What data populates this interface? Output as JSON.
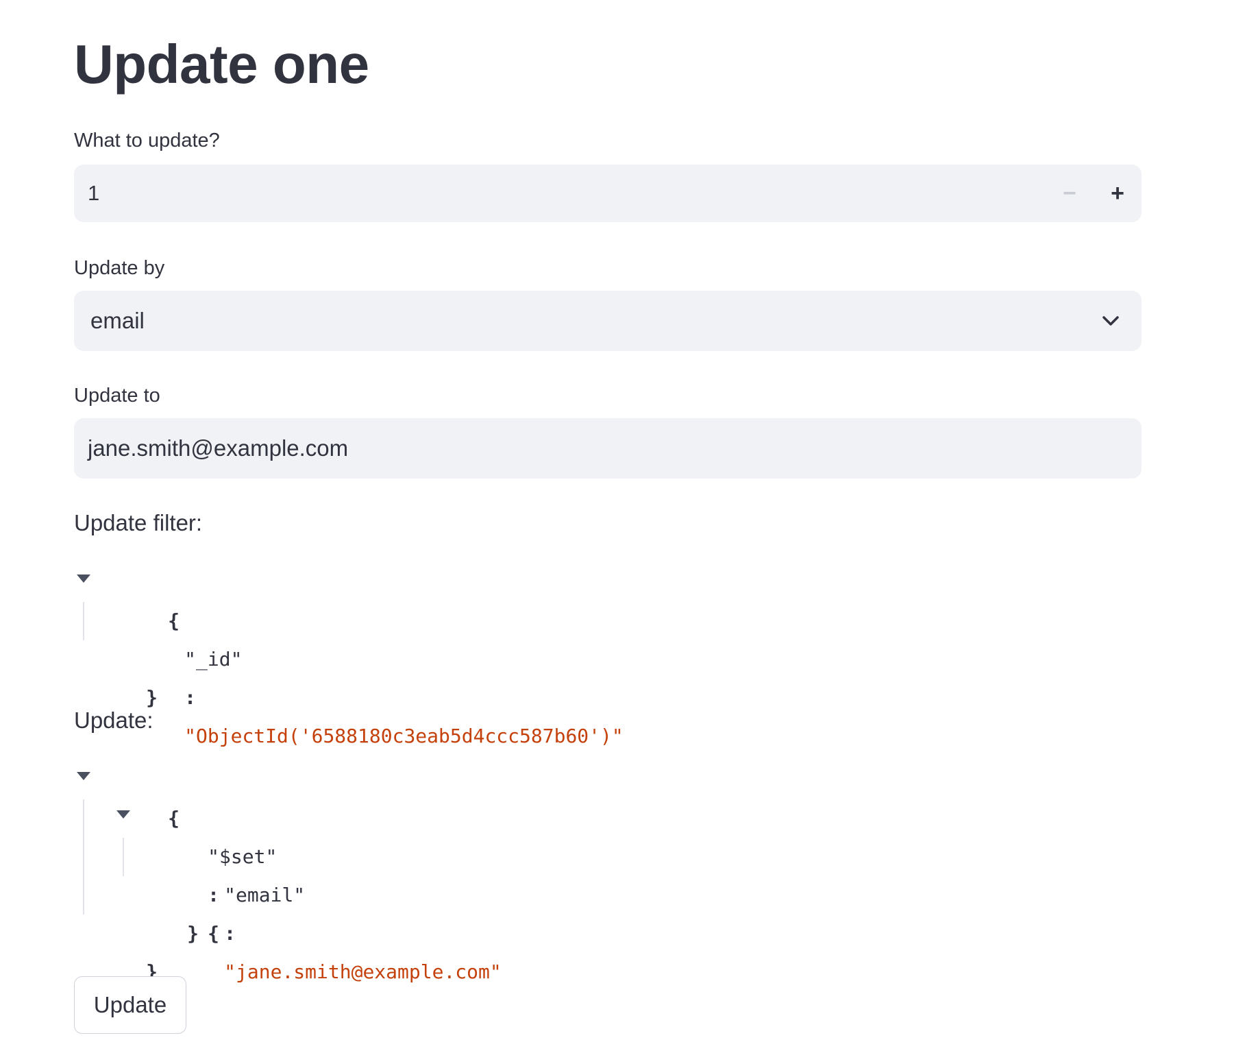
{
  "page": {
    "title": "Update one"
  },
  "what_to_update": {
    "label": "What to update?",
    "value": "1",
    "minus_symbol": "−",
    "plus_symbol": "+"
  },
  "update_by": {
    "label": "Update by",
    "selected": "email"
  },
  "update_to": {
    "label": "Update to",
    "value": "jane.smith@example.com"
  },
  "update_filter": {
    "label": "Update filter:",
    "open_brace": "{",
    "close_brace": "}",
    "key": "\"_id\"",
    "colon": ":",
    "value": "\"ObjectId('6588180c3eab5d4ccc587b60')\""
  },
  "update": {
    "label": "Update:",
    "open_brace": "{",
    "close_brace": "}",
    "set_key": "\"$set\"",
    "colon": ":",
    "set_open_brace": "{",
    "set_close_brace": "}",
    "email_key": "\"email\"",
    "email_value": "\"jane.smith@example.com\""
  },
  "button": {
    "label": "Update"
  }
}
